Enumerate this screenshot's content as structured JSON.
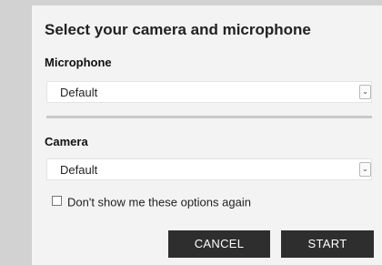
{
  "dialog": {
    "title": "Select your camera and microphone",
    "microphone": {
      "label": "Microphone",
      "selected": "Default"
    },
    "camera": {
      "label": "Camera",
      "selected": "Default"
    },
    "dont_show_again": {
      "label": "Don't show me these options again",
      "checked": false
    },
    "buttons": {
      "cancel": "CANCEL",
      "start": "START"
    }
  },
  "icons": {
    "dropdown_arrow": "chevron-down-icon"
  },
  "colors": {
    "button_bg": "#2e2e2e",
    "dialog_bg": "#f3f3f3"
  }
}
